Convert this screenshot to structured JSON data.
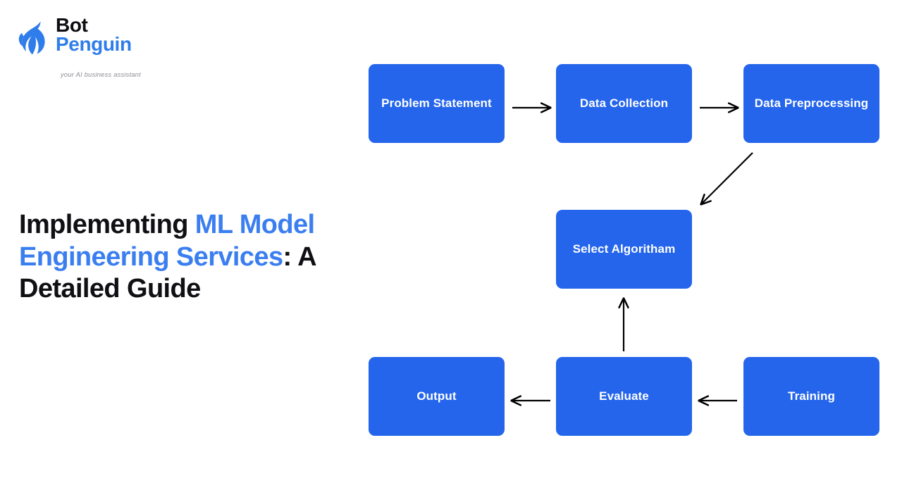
{
  "page": {
    "background_color": "#ffffff"
  },
  "logo": {
    "mark_icon": "penguin-icon",
    "mark_color": "#2f7dea",
    "line1": "Bot",
    "line1_color": "#0d0d12",
    "line2": "Penguin",
    "line2_color": "#2f7dea",
    "tagline": "your AI business assistant",
    "tagline_color": "#8d8f96"
  },
  "headline": {
    "part1": "Implementing ",
    "accent": "ML Model Engineering Services",
    "part2": ": A Detailed Guide",
    "accent_color": "#3b7ef0",
    "text_color": "#101014"
  },
  "diagram": {
    "type": "flowchart",
    "node_fill": "#2465ec",
    "node_text_color": "#ffffff",
    "arrow_color": "#000000",
    "nodes": [
      {
        "id": "problem",
        "label": "Problem Statement"
      },
      {
        "id": "collection",
        "label": "Data Collection"
      },
      {
        "id": "preprocess",
        "label": "Data Preprocessing"
      },
      {
        "id": "select",
        "label": "Select Algoritham"
      },
      {
        "id": "output",
        "label": "Output"
      },
      {
        "id": "evaluate",
        "label": "Evaluate"
      },
      {
        "id": "training",
        "label": "Training"
      }
    ],
    "edges": [
      {
        "from": "problem",
        "to": "collection",
        "direction": "right"
      },
      {
        "from": "collection",
        "to": "preprocess",
        "direction": "right"
      },
      {
        "from": "preprocess",
        "to": "select",
        "direction": "diagonal-down-left"
      },
      {
        "from": "training",
        "to": "evaluate",
        "direction": "left"
      },
      {
        "from": "evaluate",
        "to": "output",
        "direction": "left"
      },
      {
        "from": "evaluate",
        "to": "select",
        "direction": "up"
      }
    ]
  }
}
